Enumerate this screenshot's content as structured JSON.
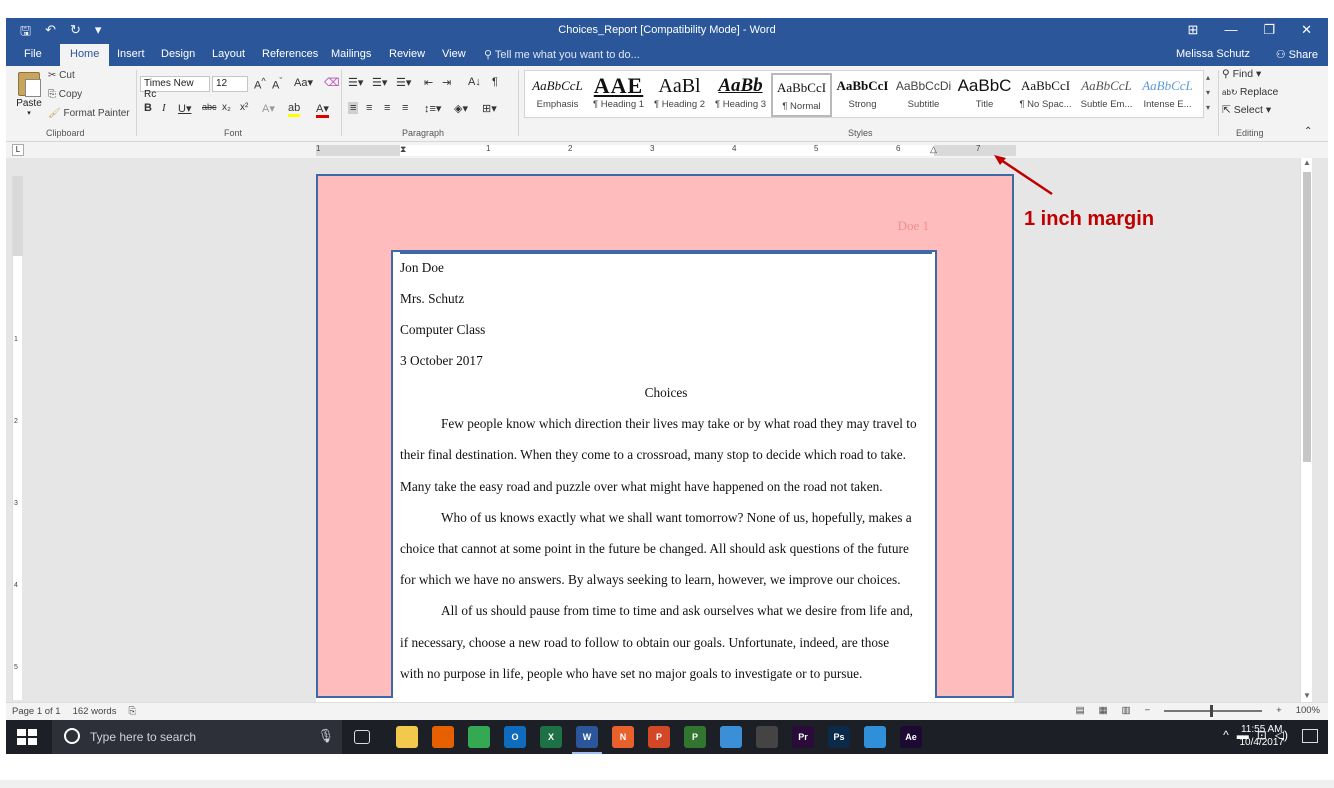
{
  "window": {
    "title": "Choices_Report [Compatibility Mode] - Word",
    "minimize_icon": "minimize-icon",
    "restore_icon": "restore-icon",
    "close_icon": "close-icon"
  },
  "tabs": [
    {
      "label": "File"
    },
    {
      "label": "Home"
    },
    {
      "label": "Insert"
    },
    {
      "label": "Design"
    },
    {
      "label": "Layout"
    },
    {
      "label": "References"
    },
    {
      "label": "Mailings"
    },
    {
      "label": "Review"
    },
    {
      "label": "View"
    }
  ],
  "tellme": "Tell me what you want to do...",
  "user": "Melissa Schutz",
  "share": "Share",
  "clipboard": {
    "paste": "Paste",
    "cut": "Cut",
    "copy": "Copy",
    "format_painter": "Format Painter",
    "label": "Clipboard"
  },
  "font": {
    "name": "Times New Rc",
    "size": "12",
    "label": "Font"
  },
  "paragraph": {
    "label": "Paragraph"
  },
  "styles": {
    "label": "Styles",
    "items": [
      {
        "sample": "AaBbCcL",
        "name": "Emphasis"
      },
      {
        "sample": "AAE",
        "name": "¶ Heading 1"
      },
      {
        "sample": "AaBl",
        "name": "¶ Heading 2"
      },
      {
        "sample": "AaBb",
        "name": "¶ Heading 3"
      },
      {
        "sample": "AaBbCcI",
        "name": "¶ Normal"
      },
      {
        "sample": "AaBbCcI",
        "name": "Strong"
      },
      {
        "sample": "AaBbCcDi",
        "name": "Subtitle"
      },
      {
        "sample": "AaBbC",
        "name": "Title"
      },
      {
        "sample": "AaBbCcI",
        "name": "¶ No Spac..."
      },
      {
        "sample": "AaBbCcL",
        "name": "Subtle Em..."
      },
      {
        "sample": "AaBbCcL",
        "name": "Intense E..."
      }
    ]
  },
  "editing": {
    "find": "Find",
    "replace": "Replace",
    "select": "Select",
    "label": "Editing"
  },
  "ruler": {
    "numbers": [
      "1",
      "1",
      "2",
      "3",
      "4",
      "5",
      "6",
      "7"
    ]
  },
  "document": {
    "header": "Doe 1",
    "lines": [
      "Jon Doe",
      "Mrs. Schutz",
      "Computer Class",
      "3 October 2017",
      "Choices",
      "Few people know which direction their lives may take or by what road they may travel to",
      "their final destination.  When they come to a crossroad, many stop to decide which road to take.",
      "Many take the easy road and puzzle over what might have happened on the road not taken.",
      "Who of us knows exactly what we shall want tomorrow?  None of us, hopefully, makes a",
      "choice that cannot at some point in the future be changed.  All should ask questions of the future",
      "for which we have no answers.  By always seeking to learn, however, we improve our choices.",
      "All of us should pause from time to time and ask ourselves what we desire from life and,",
      "if necessary, choose a new road to follow to obtain our goals.  Unfortunate, indeed, are those",
      "with no purpose in life, people who have set no major goals to investigate or to pursue."
    ]
  },
  "annotation": "1 inch margin",
  "status": {
    "page": "Page 1 of 1",
    "words": "162 words",
    "zoom": "100%"
  },
  "taskbar": {
    "search_placeholder": "Type here to search",
    "time": "11:55 AM",
    "date": "10/4/2017",
    "apps": [
      {
        "name": "file-explorer-icon",
        "label": "",
        "color": "#f2c94c"
      },
      {
        "name": "firefox-icon",
        "label": "",
        "color": "#e66000"
      },
      {
        "name": "chrome-icon",
        "label": "",
        "color": "#34a853"
      },
      {
        "name": "outlook-icon",
        "label": "O",
        "color": "#0f6cbd"
      },
      {
        "name": "excel-icon",
        "label": "X",
        "color": "#1e7145"
      },
      {
        "name": "word-icon",
        "label": "W",
        "color": "#2b579a"
      },
      {
        "name": "onenote-icon",
        "label": "N",
        "color": "#e8612c"
      },
      {
        "name": "powerpoint-icon",
        "label": "P",
        "color": "#d24726"
      },
      {
        "name": "project-icon",
        "label": "P",
        "color": "#31752f"
      },
      {
        "name": "notepad-icon",
        "label": "",
        "color": "#3b8fd6"
      },
      {
        "name": "calculator-icon",
        "label": "",
        "color": "#444444"
      },
      {
        "name": "premiere-icon",
        "label": "Pr",
        "color": "#2a0b3a"
      },
      {
        "name": "photoshop-icon",
        "label": "Ps",
        "color": "#0b2a4a"
      },
      {
        "name": "remote-desktop-icon",
        "label": "",
        "color": "#2f8fd8"
      },
      {
        "name": "after-effects-icon",
        "label": "Ae",
        "color": "#1d0a33"
      }
    ]
  }
}
